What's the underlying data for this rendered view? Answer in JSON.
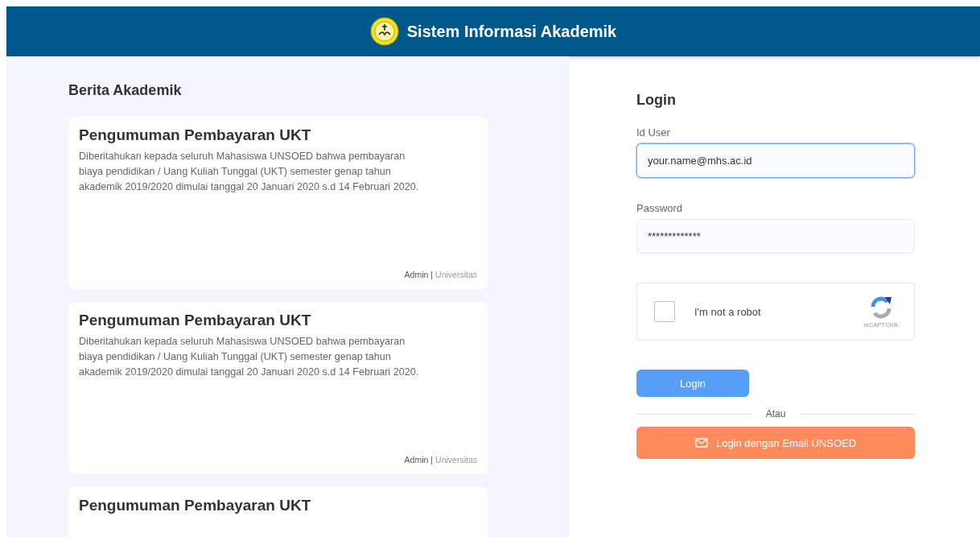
{
  "header": {
    "title": "Sistem Informasi Akademik"
  },
  "news": {
    "heading": "Berita Akademik",
    "items": [
      {
        "title": "Pengumuman Pembayaran UKT",
        "body": "Diberitahukan kepada seluruh Mahasiswa UNSOED bahwa pembayaran biaya pendidikan / Uang Kuliah Tunggal (UKT) semester genap tahun akademik 2019/2020 dimulai tanggal 20 Januari 2020 s.d 14 Februari 2020.",
        "author": "Admin",
        "separator": "|",
        "category": "Universitas"
      },
      {
        "title": "Pengumuman Pembayaran UKT",
        "body": "Diberitahukan kepada seluruh Mahasiswa UNSOED bahwa pembayaran biaya pendidikan / Uang Kuliah Tunggal (UKT) semester genap tahun akademik 2019/2020 dimulai tanggal 20 Januari 2020 s.d 14 Februari 2020.",
        "author": "Admin",
        "separator": "|",
        "category": "Universitas"
      },
      {
        "title": "Pengumuman Pembayaran UKT"
      }
    ]
  },
  "login": {
    "heading": "Login",
    "fields": [
      {
        "label": "Id User",
        "value": "your.name@mhs.ac.id",
        "focused": true
      },
      {
        "label": "Password",
        "value": "*************",
        "focused": false
      }
    ],
    "captcha": {
      "label": "I'm not a robot",
      "checked": false,
      "brand": "reCAPTCHA"
    },
    "submit": "Login",
    "divider": "Atau",
    "sso": "Login dengan Email UNSOED"
  }
}
